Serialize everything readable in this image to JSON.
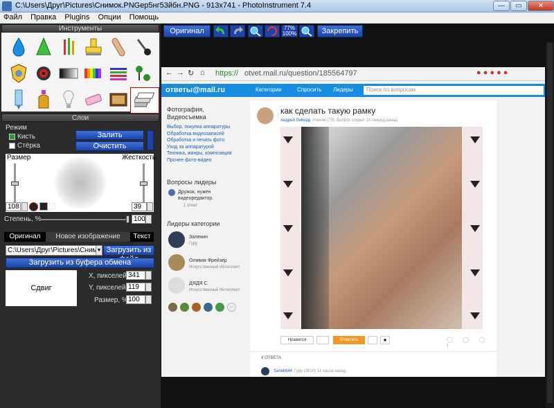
{
  "window": {
    "title": "C:\\Users\\Друг\\Pictures\\Снимок.PNGep5нг53йбн.PNG - 913x741 - PhotoInstrument 7.4",
    "minimize": "—",
    "maximize": "▭",
    "close": "✕"
  },
  "menu": [
    "Файл",
    "Правка",
    "Plugins",
    "Опции",
    "Помощь"
  ],
  "tools_panel": {
    "title": "Инструменты"
  },
  "layers_panel": {
    "title": "Слои",
    "mode_label": "Режим",
    "brush_label": "Кисть",
    "eraser_label": "Стёрка",
    "fill_button": "Залить",
    "clear_button": "Очистить",
    "size_label": "Размер",
    "hardness_label": "Жесткость",
    "size_value": "108",
    "hardness_value": "39",
    "degree_label": "Степень, %",
    "degree_value": "100"
  },
  "source_tabs": {
    "original": "Оригинал",
    "new_image": "Новое изображение",
    "text": "Текст"
  },
  "file_path": "C:\\Users\\Друг\\Pictures\\Снимок",
  "load_file_button": "Загрузить из файл",
  "load_clipboard_button": "Загрузить из буфера обмена",
  "shift": {
    "preview_label": "Сдвиг",
    "x_label": "X, пикселей",
    "x_value": "341",
    "y_label": "Y, пикселей",
    "y_value": "119",
    "size_label": "Размер, %",
    "size_value": "100"
  },
  "toolbar": {
    "original_button": "Оригинал",
    "zoom_top": "77%",
    "zoom_bottom": "100%",
    "pin_button": "Закрепить"
  },
  "browser": {
    "url_prefix": "https://",
    "url": "otvet.mail.ru/question/185564797",
    "logo": "ответы@mail.ru",
    "nav_categories": "Категории",
    "nav_ask": "Спросить",
    "nav_leaders": "Лидеры",
    "search_placeholder": "Поиск по вопросам",
    "sidebar": {
      "category": "Фотография, Видеосъемка",
      "links": [
        "Выбор, покупка аппаратуры",
        "Обработка видеозаписей",
        "Обработка и печать фото",
        "Уход за аппаратурой",
        "Техника, жанры, композиция",
        "Прочее фото-видео"
      ],
      "questions_title": "Вопросы лидеры",
      "question_text": "Дружок, нужен видеоредактор.",
      "question_meta": "1 ответ",
      "leaders_title": "Лидеры категории",
      "leaders": [
        {
          "name": "Залекин",
          "rank": "Гуру"
        },
        {
          "name": "Оливия Фрейзер",
          "rank": "Искусственный Интеллект"
        },
        {
          "name": "ДЯДЯ С",
          "rank": "Искусственный Интеллект"
        }
      ],
      "more": "···"
    },
    "question": {
      "title": "как сделать такую рамку",
      "author": "Андрей Ли6ерд",
      "author_meta": "Ученик (79). Вопрос открыт 10 секунд назад",
      "like_button": "Нравится",
      "answer_button": "Ответить",
      "answers_count": "4 ОТВЕТА",
      "answer_author": "Sanek644",
      "answer_meta": "Гуру (3810) 11 часов назад"
    }
  }
}
